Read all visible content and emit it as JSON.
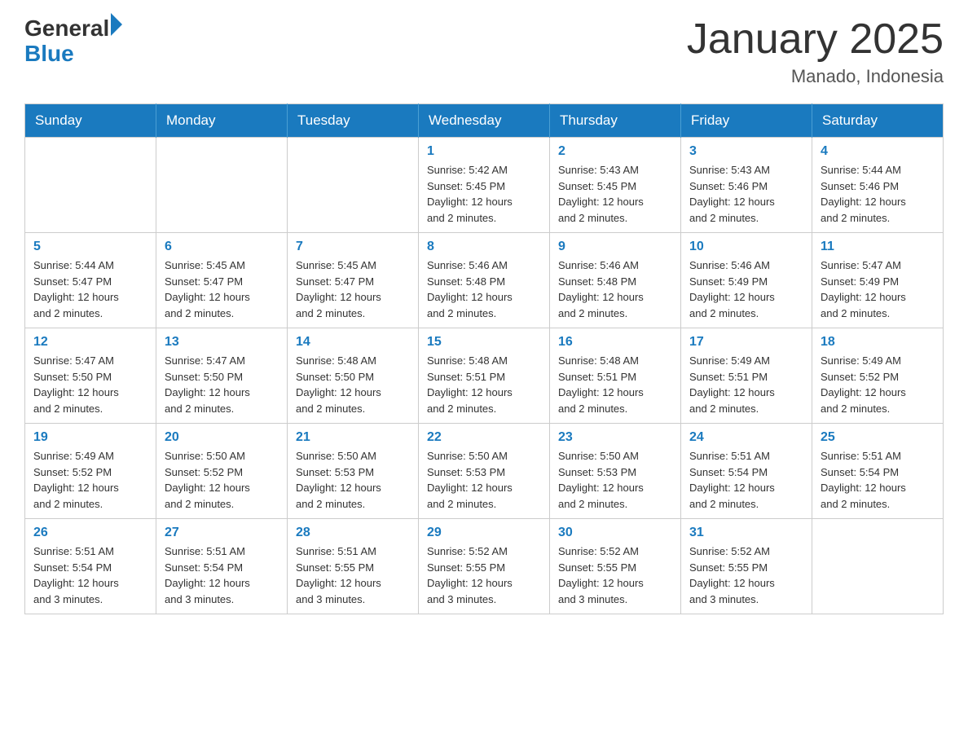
{
  "logo": {
    "general": "General",
    "blue": "Blue"
  },
  "title": "January 2025",
  "subtitle": "Manado, Indonesia",
  "days_header": [
    "Sunday",
    "Monday",
    "Tuesday",
    "Wednesday",
    "Thursday",
    "Friday",
    "Saturday"
  ],
  "weeks": [
    [
      {
        "day": "",
        "info": ""
      },
      {
        "day": "",
        "info": ""
      },
      {
        "day": "",
        "info": ""
      },
      {
        "day": "1",
        "info": "Sunrise: 5:42 AM\nSunset: 5:45 PM\nDaylight: 12 hours\nand 2 minutes."
      },
      {
        "day": "2",
        "info": "Sunrise: 5:43 AM\nSunset: 5:45 PM\nDaylight: 12 hours\nand 2 minutes."
      },
      {
        "day": "3",
        "info": "Sunrise: 5:43 AM\nSunset: 5:46 PM\nDaylight: 12 hours\nand 2 minutes."
      },
      {
        "day": "4",
        "info": "Sunrise: 5:44 AM\nSunset: 5:46 PM\nDaylight: 12 hours\nand 2 minutes."
      }
    ],
    [
      {
        "day": "5",
        "info": "Sunrise: 5:44 AM\nSunset: 5:47 PM\nDaylight: 12 hours\nand 2 minutes."
      },
      {
        "day": "6",
        "info": "Sunrise: 5:45 AM\nSunset: 5:47 PM\nDaylight: 12 hours\nand 2 minutes."
      },
      {
        "day": "7",
        "info": "Sunrise: 5:45 AM\nSunset: 5:47 PM\nDaylight: 12 hours\nand 2 minutes."
      },
      {
        "day": "8",
        "info": "Sunrise: 5:46 AM\nSunset: 5:48 PM\nDaylight: 12 hours\nand 2 minutes."
      },
      {
        "day": "9",
        "info": "Sunrise: 5:46 AM\nSunset: 5:48 PM\nDaylight: 12 hours\nand 2 minutes."
      },
      {
        "day": "10",
        "info": "Sunrise: 5:46 AM\nSunset: 5:49 PM\nDaylight: 12 hours\nand 2 minutes."
      },
      {
        "day": "11",
        "info": "Sunrise: 5:47 AM\nSunset: 5:49 PM\nDaylight: 12 hours\nand 2 minutes."
      }
    ],
    [
      {
        "day": "12",
        "info": "Sunrise: 5:47 AM\nSunset: 5:50 PM\nDaylight: 12 hours\nand 2 minutes."
      },
      {
        "day": "13",
        "info": "Sunrise: 5:47 AM\nSunset: 5:50 PM\nDaylight: 12 hours\nand 2 minutes."
      },
      {
        "day": "14",
        "info": "Sunrise: 5:48 AM\nSunset: 5:50 PM\nDaylight: 12 hours\nand 2 minutes."
      },
      {
        "day": "15",
        "info": "Sunrise: 5:48 AM\nSunset: 5:51 PM\nDaylight: 12 hours\nand 2 minutes."
      },
      {
        "day": "16",
        "info": "Sunrise: 5:48 AM\nSunset: 5:51 PM\nDaylight: 12 hours\nand 2 minutes."
      },
      {
        "day": "17",
        "info": "Sunrise: 5:49 AM\nSunset: 5:51 PM\nDaylight: 12 hours\nand 2 minutes."
      },
      {
        "day": "18",
        "info": "Sunrise: 5:49 AM\nSunset: 5:52 PM\nDaylight: 12 hours\nand 2 minutes."
      }
    ],
    [
      {
        "day": "19",
        "info": "Sunrise: 5:49 AM\nSunset: 5:52 PM\nDaylight: 12 hours\nand 2 minutes."
      },
      {
        "day": "20",
        "info": "Sunrise: 5:50 AM\nSunset: 5:52 PM\nDaylight: 12 hours\nand 2 minutes."
      },
      {
        "day": "21",
        "info": "Sunrise: 5:50 AM\nSunset: 5:53 PM\nDaylight: 12 hours\nand 2 minutes."
      },
      {
        "day": "22",
        "info": "Sunrise: 5:50 AM\nSunset: 5:53 PM\nDaylight: 12 hours\nand 2 minutes."
      },
      {
        "day": "23",
        "info": "Sunrise: 5:50 AM\nSunset: 5:53 PM\nDaylight: 12 hours\nand 2 minutes."
      },
      {
        "day": "24",
        "info": "Sunrise: 5:51 AM\nSunset: 5:54 PM\nDaylight: 12 hours\nand 2 minutes."
      },
      {
        "day": "25",
        "info": "Sunrise: 5:51 AM\nSunset: 5:54 PM\nDaylight: 12 hours\nand 2 minutes."
      }
    ],
    [
      {
        "day": "26",
        "info": "Sunrise: 5:51 AM\nSunset: 5:54 PM\nDaylight: 12 hours\nand 3 minutes."
      },
      {
        "day": "27",
        "info": "Sunrise: 5:51 AM\nSunset: 5:54 PM\nDaylight: 12 hours\nand 3 minutes."
      },
      {
        "day": "28",
        "info": "Sunrise: 5:51 AM\nSunset: 5:55 PM\nDaylight: 12 hours\nand 3 minutes."
      },
      {
        "day": "29",
        "info": "Sunrise: 5:52 AM\nSunset: 5:55 PM\nDaylight: 12 hours\nand 3 minutes."
      },
      {
        "day": "30",
        "info": "Sunrise: 5:52 AM\nSunset: 5:55 PM\nDaylight: 12 hours\nand 3 minutes."
      },
      {
        "day": "31",
        "info": "Sunrise: 5:52 AM\nSunset: 5:55 PM\nDaylight: 12 hours\nand 3 minutes."
      },
      {
        "day": "",
        "info": ""
      }
    ]
  ]
}
